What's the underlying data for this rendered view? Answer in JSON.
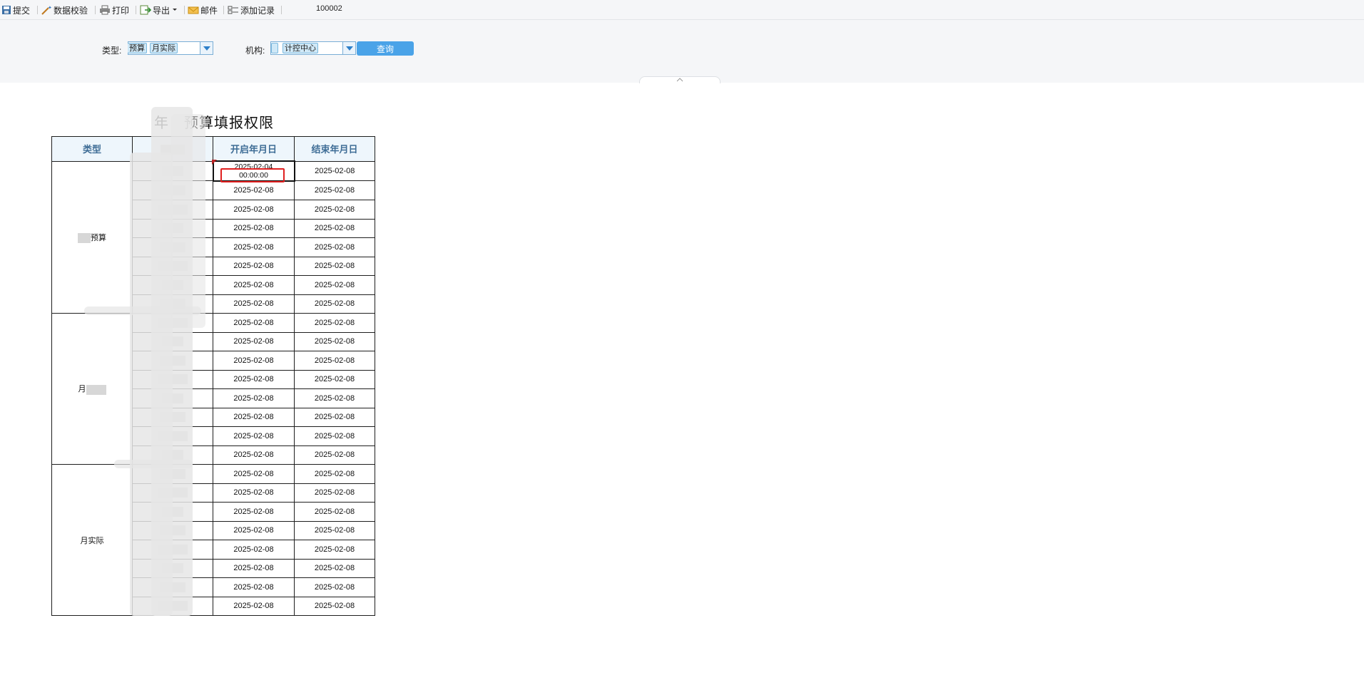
{
  "toolbar": {
    "submit": "提交",
    "validate": "数据校验",
    "print": "打印",
    "export": "导出",
    "mail": "邮件",
    "add_record": "添加记录",
    "code": "100002"
  },
  "filters": {
    "type_label": "类型:",
    "type_values": [
      "预算",
      "月实际"
    ],
    "org_label": "机构:",
    "org_values": [
      "计控中心"
    ],
    "query_button": "查询"
  },
  "report": {
    "title": "年　预算填报权限",
    "columns": [
      "类型",
      "",
      "开启年月日",
      "结束年月日"
    ],
    "groups": [
      {
        "label": "预算",
        "rows": [
          {
            "start": "2025-02-04",
            "start_time": "00:00:00",
            "end": "2025-02-08"
          },
          {
            "start": "2025-02-08",
            "end": "2025-02-08"
          },
          {
            "start": "2025-02-08",
            "end": "2025-02-08"
          },
          {
            "start": "2025-02-08",
            "end": "2025-02-08"
          },
          {
            "start": "2025-02-08",
            "end": "2025-02-08"
          },
          {
            "start": "2025-02-08",
            "end": "2025-02-08"
          },
          {
            "start": "2025-02-08",
            "end": "2025-02-08"
          },
          {
            "start": "2025-02-08",
            "end": "2025-02-08"
          }
        ]
      },
      {
        "label": "月",
        "rows": [
          {
            "start": "2025-02-08",
            "end": "2025-02-08"
          },
          {
            "start": "2025-02-08",
            "end": "2025-02-08"
          },
          {
            "start": "2025-02-08",
            "end": "2025-02-08"
          },
          {
            "start": "2025-02-08",
            "end": "2025-02-08"
          },
          {
            "start": "2025-02-08",
            "end": "2025-02-08"
          },
          {
            "start": "2025-02-08",
            "end": "2025-02-08"
          },
          {
            "start": "2025-02-08",
            "end": "2025-02-08"
          },
          {
            "start": "2025-02-08",
            "end": "2025-02-08"
          }
        ]
      },
      {
        "label": "月实际",
        "rows": [
          {
            "start": "2025-02-08",
            "end": "2025-02-08"
          },
          {
            "start": "2025-02-08",
            "end": "2025-02-08"
          },
          {
            "start": "2025-02-08",
            "end": "2025-02-08"
          },
          {
            "start": "2025-02-08",
            "end": "2025-02-08"
          },
          {
            "start": "2025-02-08",
            "end": "2025-02-08"
          },
          {
            "start": "2025-02-08",
            "end": "2025-02-08"
          },
          {
            "start": "2025-02-08",
            "end": "2025-02-08"
          },
          {
            "start": "2025-02-08",
            "end": "2025-02-08"
          }
        ]
      }
    ]
  },
  "colors": {
    "accent": "#4aa3e8",
    "header_text": "#3f6d96",
    "highlight": "#e02020"
  }
}
